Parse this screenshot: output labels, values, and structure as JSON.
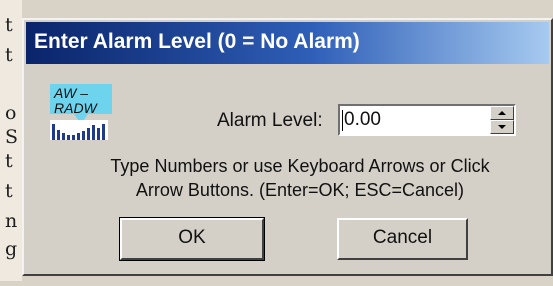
{
  "background": {
    "letters": [
      "t",
      "t",
      "o",
      "S",
      "t",
      "t",
      "n",
      "g"
    ],
    "bottom_glyph": "\""
  },
  "dialog": {
    "title": "Enter Alarm Level (0 = No Alarm)",
    "icon": {
      "name": "aw-radw-app-icon",
      "line1": "AW –",
      "line2": "RADW"
    },
    "field_label": "Alarm Level:",
    "field_value": "0.00",
    "help_line1": "Type Numbers or use Keyboard Arrows or Click",
    "help_line2": "Arrow Buttons. (Enter=OK;  ESC=Cancel)",
    "ok_label": "OK",
    "cancel_label": "Cancel"
  },
  "colors": {
    "titlebar_start": "#0a246a",
    "titlebar_end": "#a6caf0",
    "dialog_face": "#d4d0c8"
  }
}
